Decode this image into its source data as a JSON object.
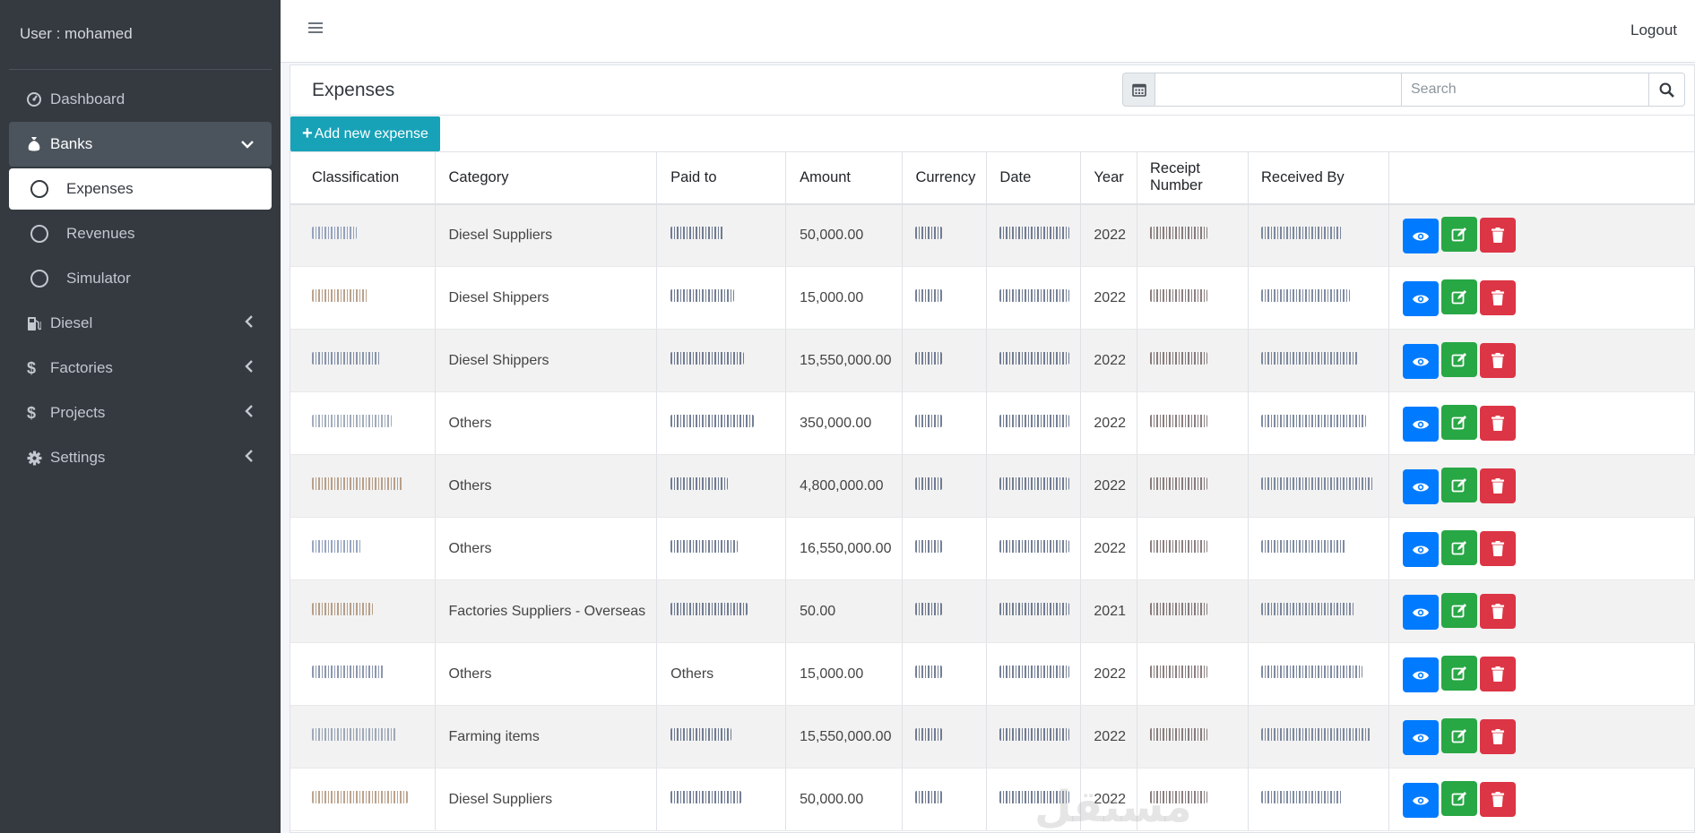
{
  "sidebar": {
    "user": "User : mohamed",
    "items": [
      {
        "label": "Dashboard"
      },
      {
        "label": "Banks"
      },
      {
        "label": "Expenses"
      },
      {
        "label": "Revenues"
      },
      {
        "label": "Simulator"
      },
      {
        "label": "Diesel"
      },
      {
        "label": "Factories"
      },
      {
        "label": "Projects"
      },
      {
        "label": "Settings"
      }
    ]
  },
  "header": {
    "logout": "Logout"
  },
  "card": {
    "title": "Expenses",
    "search_placeholder": "Search",
    "add_label": "Add new expense"
  },
  "table": {
    "columns": [
      "Classification",
      "Category",
      "Paid to",
      "Amount",
      "Currency",
      "Date",
      "Year",
      "Receipt Number",
      "Received By"
    ],
    "rows": [
      {
        "category": "Diesel Suppliers",
        "amount": "50,000.00",
        "year": "2022"
      },
      {
        "category": "Diesel Shippers",
        "amount": "15,000.00",
        "year": "2022"
      },
      {
        "category": "Diesel Shippers",
        "amount": "15,550,000.00",
        "year": "2022"
      },
      {
        "category": "Others",
        "amount": "350,000.00",
        "year": "2022"
      },
      {
        "category": "Others",
        "amount": "4,800,000.00",
        "year": "2022"
      },
      {
        "category": "Others",
        "amount": "16,550,000.00",
        "year": "2022"
      },
      {
        "category": "Factories Suppliers - Overseas",
        "amount": "50.00",
        "year": "2021"
      },
      {
        "category": "Others",
        "amount": "15,000.00",
        "year": "2022",
        "paid_to": "Others"
      },
      {
        "category": "Farming items",
        "amount": "15,550,000.00",
        "year": "2022"
      },
      {
        "category": "Diesel Suppliers",
        "amount": "50,000.00",
        "year": "2022"
      }
    ]
  },
  "watermark": "مستقل",
  "colors": {
    "sidebar": "#343a40",
    "accent": "#17a2b8",
    "view": "#007bff",
    "edit": "#28a745",
    "delete": "#dc3545"
  }
}
